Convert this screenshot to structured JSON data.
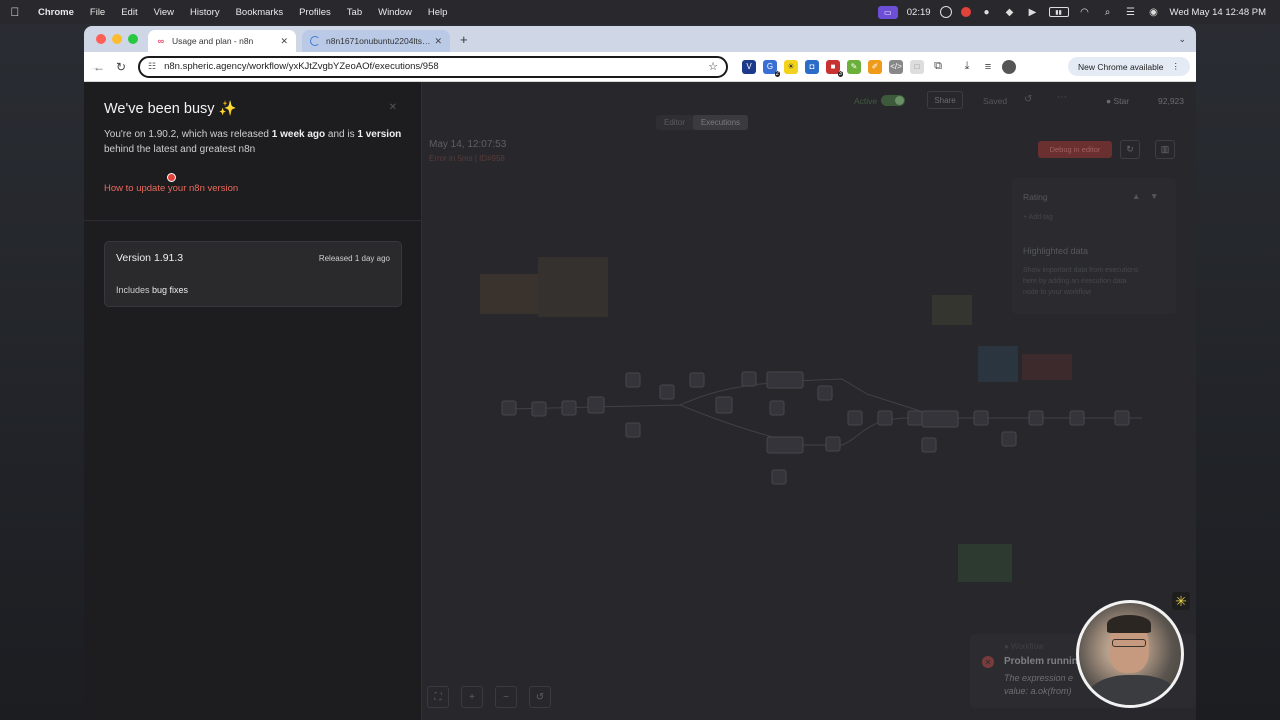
{
  "menubar": {
    "app": "Chrome",
    "items": [
      "File",
      "Edit",
      "View",
      "History",
      "Bookmarks",
      "Profiles",
      "Tab",
      "Window",
      "Help"
    ],
    "timer": "02:19",
    "datetime": "Wed May 14  12:48 PM"
  },
  "tabs": [
    {
      "title": "Usage and plan - n8n",
      "favicon": "n8n-logo-icon"
    },
    {
      "title": "n8n1671onubuntu2204lts-s-",
      "favicon": "loading-spinner-icon"
    }
  ],
  "toolbar": {
    "url": "n8n.spheric.agency/workflow/yxKJtZvgbYZeoAOf/executions/958",
    "new_chrome": "New Chrome available",
    "ext_badge_1": "2",
    "ext_badge_2": "3"
  },
  "panel": {
    "title": "We've been busy ✨",
    "desc_1": "You're on 1.90.2, which was released ",
    "desc_2": "1 week ago",
    "desc_3": " and is ",
    "desc_4": "1 version",
    "desc_5": " behind the latest and greatest n8n",
    "update_link": "How to update your n8n version",
    "version_name": "Version 1.91.3",
    "version_released": "Released 1 day ago",
    "includes": "Includes ",
    "includes_bold": "bug fixes"
  },
  "canvas": {
    "active_label": "Active",
    "share": "Share",
    "saved": "Saved",
    "star": "Star",
    "star_count": "92,923",
    "tab_editor": "Editor",
    "tab_executions": "Executions",
    "exec_date": "May 14, 12:07:53",
    "exec_meta": "Error in 5ms | ID#958",
    "debug": "Debug in editor",
    "rating": "Rating",
    "add_tag": "+ Add tag",
    "highlighted": "Highlighted data",
    "highlighted_desc_1": "Show important data from executions",
    "highlighted_desc_2": "here by adding an execution data",
    "highlighted_desc_3": "node to your workflow",
    "toast_title": "Problem running",
    "toast_body_1": "The expression e",
    "toast_body_2": "value: a.ok(from)"
  },
  "colors": {
    "accent": "#ea4b71",
    "link": "#ea6b5c"
  }
}
